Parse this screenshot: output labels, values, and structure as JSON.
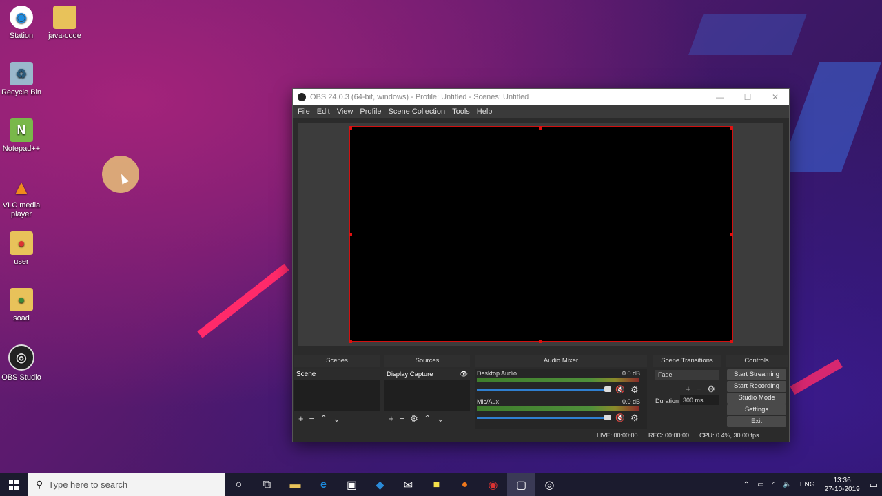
{
  "desktop": {
    "icons": [
      {
        "label": "Station",
        "icon": "station-icon",
        "color": "#1d8ce0"
      },
      {
        "label": "java-code",
        "icon": "folder-icon",
        "color": "#e8c25a"
      },
      {
        "label": "Recycle Bin",
        "icon": "recycle-bin-icon",
        "color": "#9ab8cc"
      },
      {
        "label": "Notepad++",
        "icon": "notepad-icon",
        "color": "#79b84a"
      },
      {
        "label": "VLC media player",
        "icon": "vlc-icon",
        "color": "#f08a1c"
      },
      {
        "label": "user",
        "icon": "chrome-profile-icon",
        "color": "#e8c25a"
      },
      {
        "label": "soad",
        "icon": "chrome-profile-icon",
        "color": "#e8c25a"
      },
      {
        "label": "OBS Studio",
        "icon": "obs-icon",
        "color": "#222222"
      }
    ]
  },
  "obs": {
    "title": "OBS 24.0.3 (64-bit, windows) - Profile: Untitled - Scenes: Untitled",
    "menu": [
      "File",
      "Edit",
      "View",
      "Profile",
      "Scene Collection",
      "Tools",
      "Help"
    ],
    "docks": {
      "scenes": {
        "title": "Scenes",
        "items": [
          "Scene"
        ]
      },
      "sources": {
        "title": "Sources",
        "items": [
          "Display Capture"
        ]
      },
      "mixer": {
        "title": "Audio Mixer",
        "channels": [
          {
            "name": "Desktop Audio",
            "level": "0.0 dB",
            "volume": 0.9
          },
          {
            "name": "Mic/Aux",
            "level": "0.0 dB",
            "volume": 0.9
          }
        ]
      },
      "transitions": {
        "title": "Scene Transitions",
        "selected": "Fade",
        "duration_label": "Duration",
        "duration_value": "300 ms"
      },
      "controls": {
        "title": "Controls",
        "buttons": [
          "Start Streaming",
          "Start Recording",
          "Studio Mode",
          "Settings",
          "Exit"
        ]
      }
    },
    "status": {
      "live": "LIVE: 00:00:00",
      "rec": "REC: 00:00:00",
      "cpu": "CPU: 0.4%, 30.00 fps"
    },
    "accent": "#d01010"
  },
  "taskbar": {
    "search_placeholder": "Type here to search",
    "language": "ENG",
    "time": "13:36",
    "date": "27-10-2019"
  }
}
